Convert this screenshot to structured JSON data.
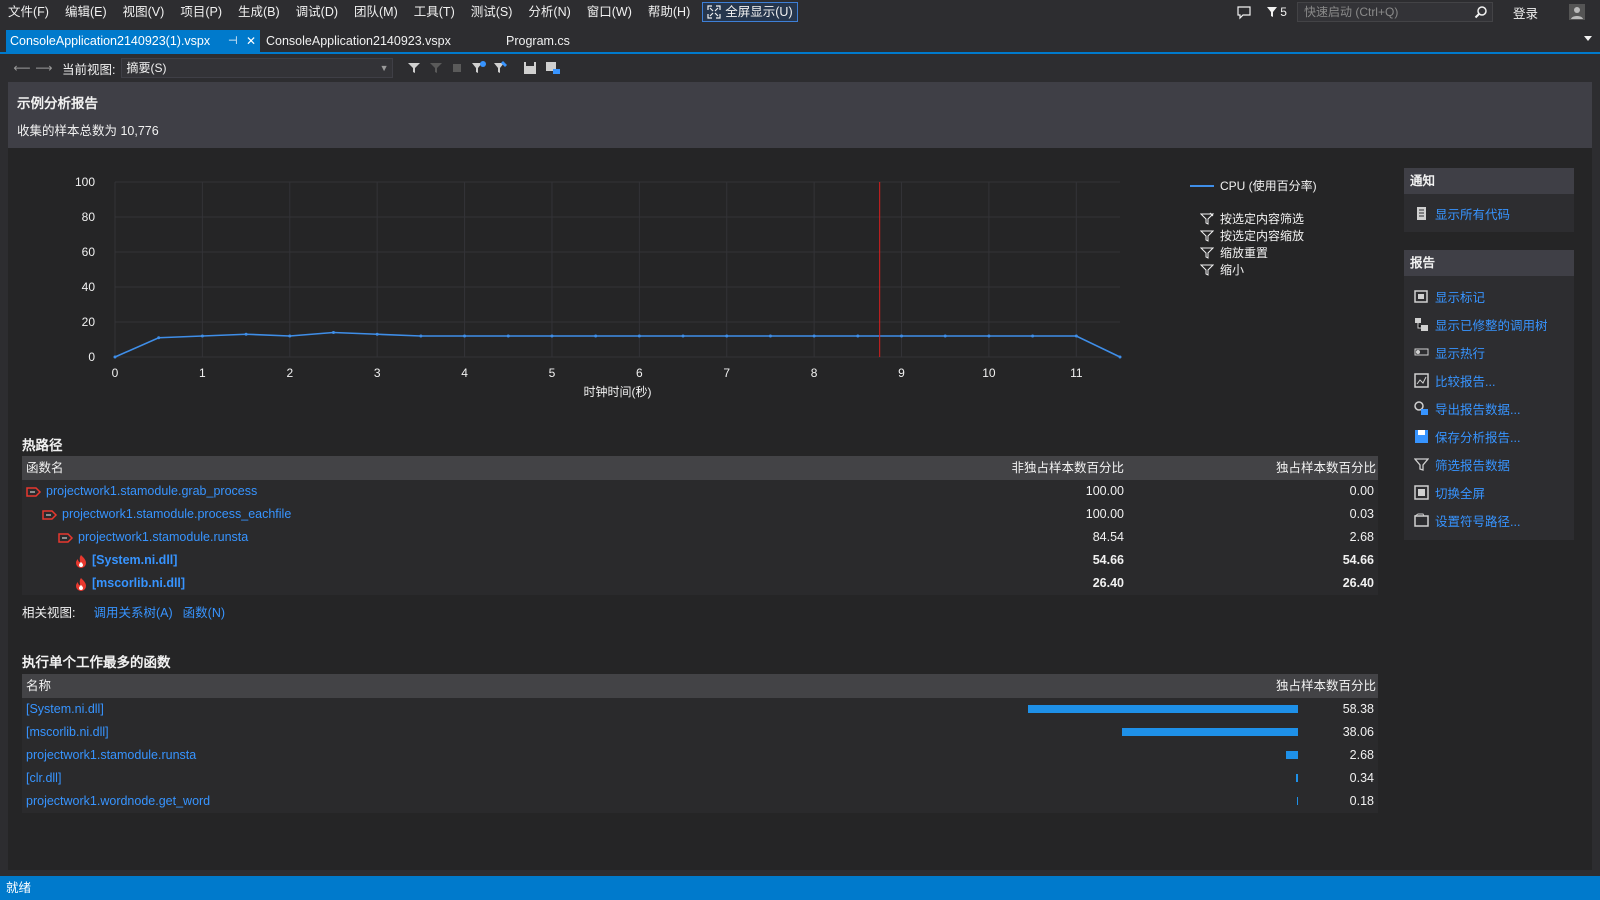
{
  "menu": [
    "文件(F)",
    "编辑(E)",
    "视图(V)",
    "项目(P)",
    "生成(B)",
    "调试(D)",
    "团队(M)",
    "工具(T)",
    "测试(S)",
    "分析(N)",
    "窗口(W)",
    "帮助(H)"
  ],
  "fullscreen_label": "全屏显示(U)",
  "filter_count": "5",
  "quick_launch_placeholder": "快速启动 (Ctrl+Q)",
  "login": "登录",
  "tabs": [
    {
      "label": "ConsoleApplication2140923(1).vspx",
      "pin": "⊣",
      "close": "✕"
    },
    {
      "label": "ConsoleApplication2140923.vspx"
    },
    {
      "label": "Program.cs"
    }
  ],
  "toolbar": {
    "current_view_label": "当前视图:",
    "view_value": "摘要(S)"
  },
  "report": {
    "title": "示例分析报告",
    "total_samples": "收集的样本总数为 10,776"
  },
  "chart_data": {
    "type": "line",
    "xlabel": "时钟时间(秒)",
    "ylabel": "",
    "xlim": [
      0,
      11.5
    ],
    "ylim": [
      0,
      100
    ],
    "x_ticks": [
      "0",
      "1",
      "2",
      "3",
      "4",
      "5",
      "6",
      "7",
      "8",
      "9",
      "10",
      "11"
    ],
    "y_ticks": [
      "0",
      "20",
      "40",
      "60",
      "80",
      "100"
    ],
    "series": [
      {
        "name": "CPU (使用百分率)",
        "color": "#3f8ee8",
        "x": [
          0,
          0.5,
          1,
          1.5,
          2,
          2.5,
          3,
          3.5,
          4,
          4.5,
          5,
          5.5,
          6,
          6.5,
          7,
          7.5,
          8,
          8.5,
          9,
          9.5,
          10,
          10.5,
          11,
          11.5
        ],
        "y": [
          0,
          11,
          12,
          13,
          12,
          14,
          13,
          12,
          12,
          12,
          12,
          12,
          12,
          12,
          12,
          12,
          12,
          12,
          12,
          12,
          12,
          12,
          12,
          0
        ]
      }
    ],
    "marker_x": 8.75,
    "marker_color": "#d81e1e",
    "grid": true,
    "legend": "top-right"
  },
  "chart_actions": [
    "按选定内容筛选",
    "按选定内容缩放",
    "缩放重置",
    "缩小"
  ],
  "side": {
    "notify_title": "通知",
    "notify_links": [
      "显示所有代码"
    ],
    "report_title": "报告",
    "report_links": [
      "显示标记",
      "显示已修整的调用树",
      "显示热行",
      "比较报告...",
      "导出报告数据...",
      "保存分析报告...",
      "筛选报告数据",
      "切换全屏",
      "设置符号路径..."
    ]
  },
  "hot_path": {
    "title": "热路径",
    "headers": {
      "name": "函数名",
      "inclusive": "非独占样本数百分比",
      "exclusive": "独占样本数百分比"
    },
    "rows": [
      {
        "name": "projectwork1.stamodule.grab_process",
        "inclusive": "100.00",
        "exclusive": "0.00",
        "indent": 0,
        "hot": false
      },
      {
        "name": "projectwork1.stamodule.process_eachfile",
        "inclusive": "100.00",
        "exclusive": "0.03",
        "indent": 1,
        "hot": false
      },
      {
        "name": "projectwork1.stamodule.runsta",
        "inclusive": "84.54",
        "exclusive": "2.68",
        "indent": 2,
        "hot": false
      },
      {
        "name": "[System.ni.dll]",
        "inclusive": "54.66",
        "exclusive": "54.66",
        "indent": 3,
        "hot": true
      },
      {
        "name": "[mscorlib.ni.dll]",
        "inclusive": "26.40",
        "exclusive": "26.40",
        "indent": 3,
        "hot": true
      }
    ],
    "related_label": "相关视图:",
    "related_links": [
      "调用关系树(A)",
      "函数(N)"
    ]
  },
  "top_functions": {
    "title": "执行单个工作最多的函数",
    "headers": {
      "name": "名称",
      "exclusive": "独占样本数百分比"
    },
    "rows": [
      {
        "name": "[System.ni.dll]",
        "value": "58.38",
        "pct": 58.38
      },
      {
        "name": "[mscorlib.ni.dll]",
        "value": "38.06",
        "pct": 38.06
      },
      {
        "name": "projectwork1.stamodule.runsta",
        "value": "2.68",
        "pct": 2.68
      },
      {
        "name": "[clr.dll]",
        "value": "0.34",
        "pct": 0.34
      },
      {
        "name": "projectwork1.wordnode.get_word",
        "value": "0.18",
        "pct": 0.18
      }
    ]
  },
  "status": "就绪"
}
